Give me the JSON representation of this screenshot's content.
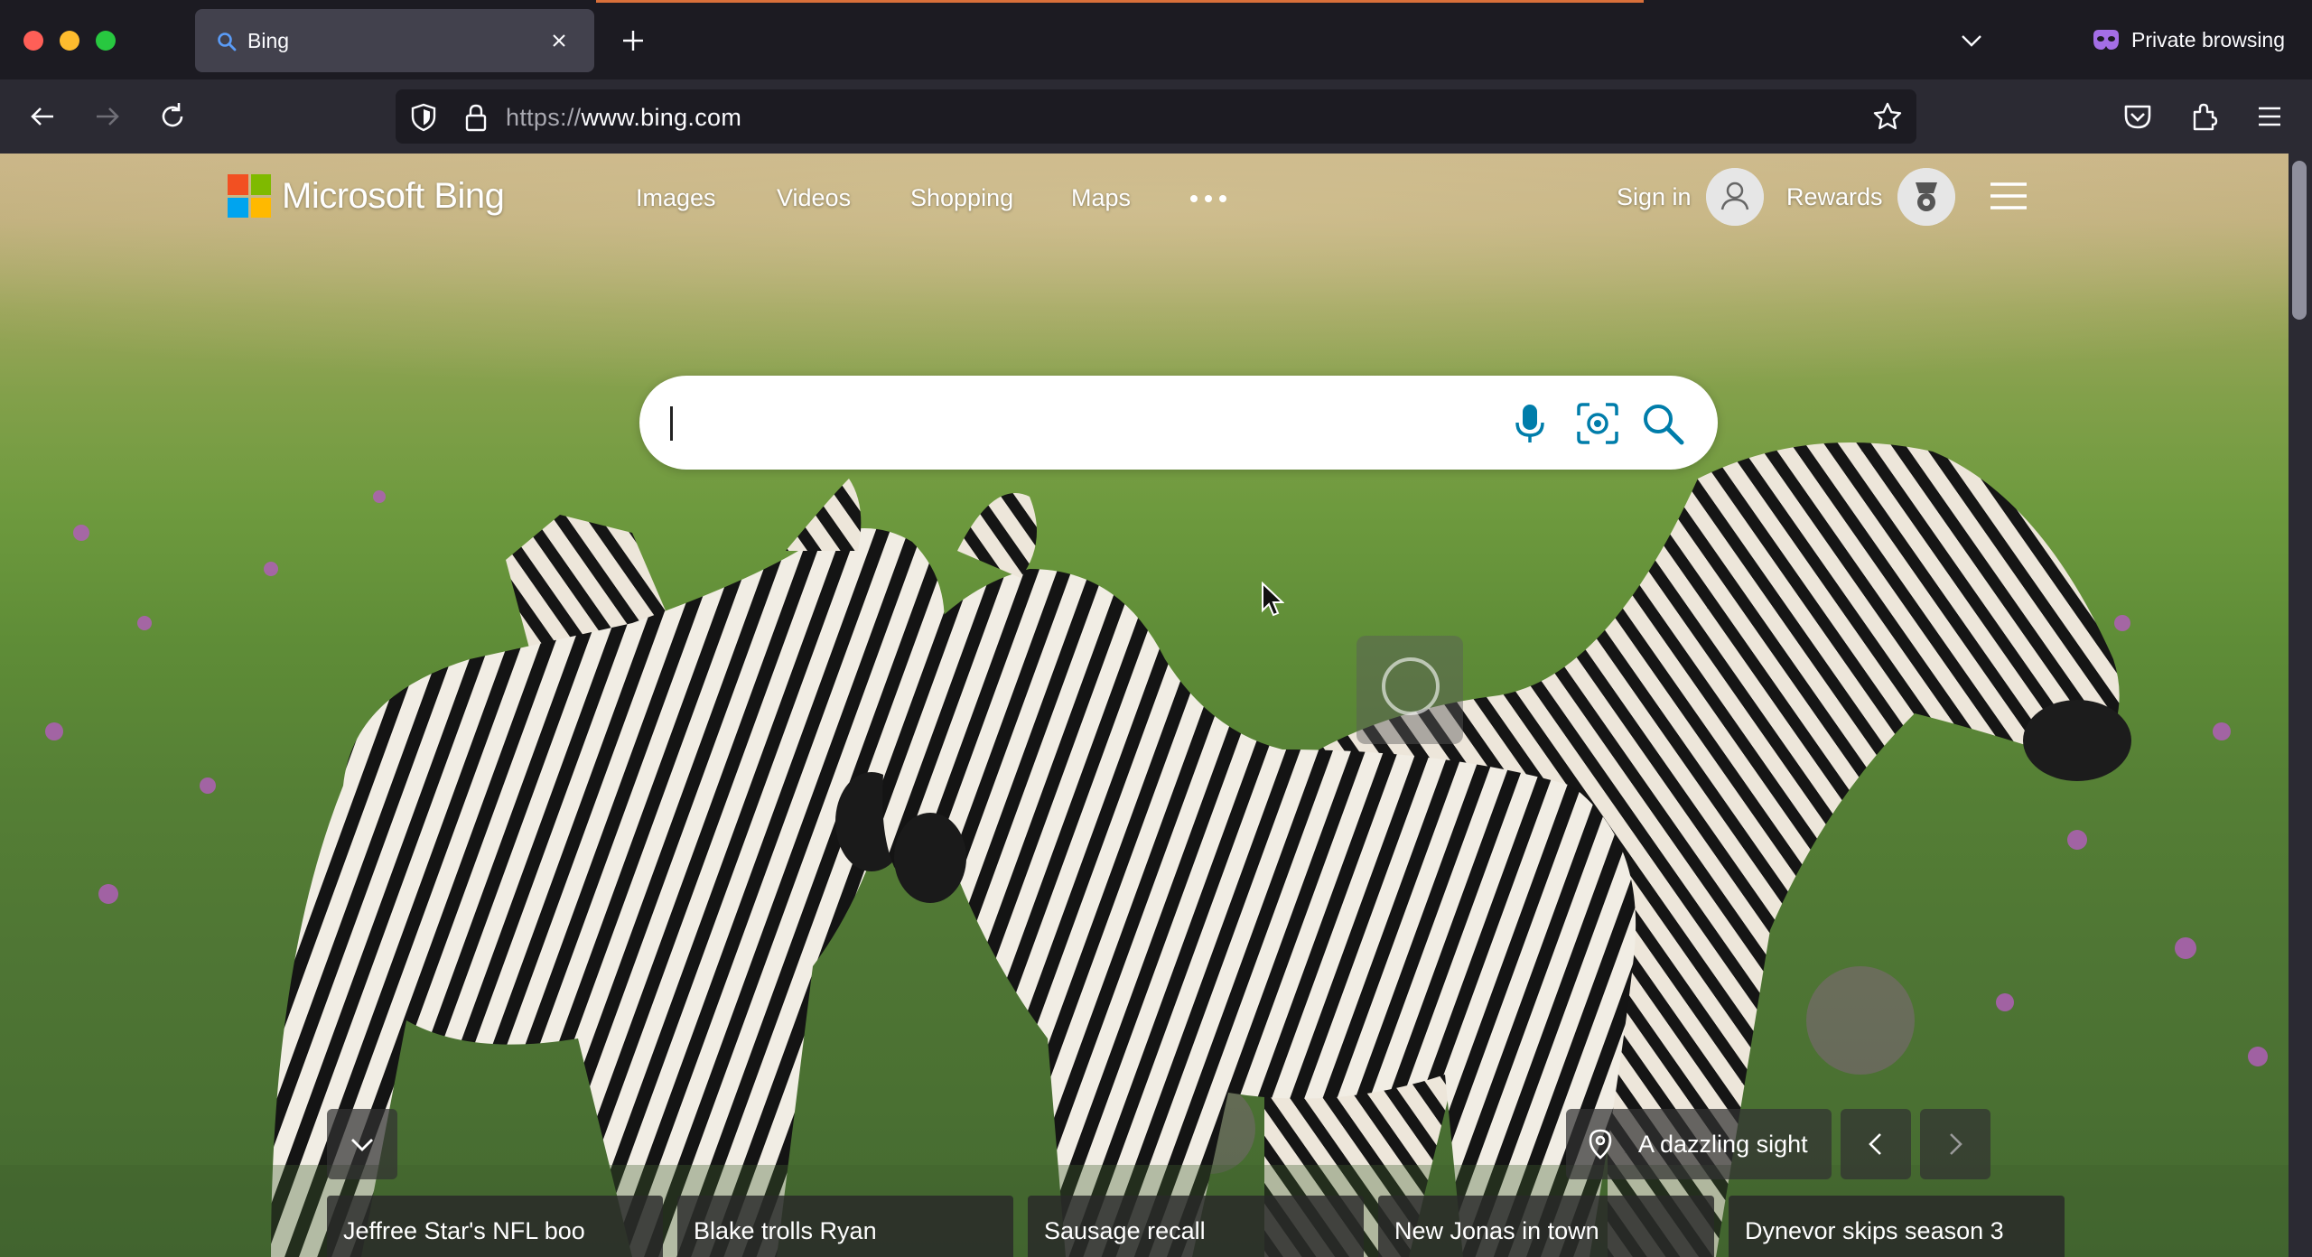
{
  "window": {
    "traffic_lights": [
      "close",
      "minimize",
      "maximize"
    ],
    "colors": {
      "frame": "#1c1b22",
      "toolbar": "#2b2a33",
      "tab_active": "#42414d",
      "accent": "#d9703a"
    }
  },
  "tabs": [
    {
      "title": "Bing",
      "icon": "search-icon",
      "active": true
    }
  ],
  "private_browsing": {
    "label": "Private browsing",
    "icon": "private-mask-icon"
  },
  "navbar": {
    "url_scheme": "https://",
    "url_host": "www.bing.com",
    "icons": [
      "back-arrow-icon",
      "forward-arrow-icon",
      "reload-icon",
      "tracking-shield-icon",
      "lock-icon",
      "bookmark-star-icon",
      "pocket-icon",
      "extensions-icon",
      "app-menu-icon"
    ]
  },
  "bing": {
    "brand": "Microsoft Bing",
    "logo_colors": [
      "#f25022",
      "#7fba00",
      "#00a4ef",
      "#ffb900"
    ],
    "nav": [
      "Images",
      "Videos",
      "Shopping",
      "Maps"
    ],
    "more_icon": "more-dots-icon",
    "sign_in": "Sign in",
    "rewards": "Rewards",
    "search": {
      "value": "",
      "placeholder": "",
      "icons": [
        "microphone-icon",
        "visual-search-icon",
        "search-icon"
      ],
      "accent": "#007daa"
    },
    "image_info": {
      "title": "A dazzling sight",
      "icon": "location-pin-icon"
    },
    "news": [
      "Jeffree Star's NFL boo",
      "Blake trolls Ryan",
      "Sausage recall",
      "New Jonas in town",
      "Dynevor skips season 3"
    ]
  }
}
